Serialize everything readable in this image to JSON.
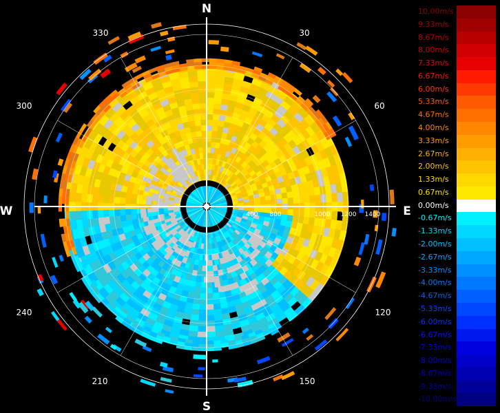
{
  "chart_data": {
    "type": "radar-ppi",
    "compass": {
      "north": "N",
      "east": "E",
      "south": "S",
      "west": "W"
    },
    "azimuth_labels": [
      "30",
      "60",
      "120",
      "150",
      "210",
      "240",
      "300",
      "330"
    ],
    "range_labels": [
      "400",
      "800",
      "1000",
      "1200",
      "1400"
    ],
    "legend": [
      {
        "label": "10.00m/s",
        "color": "#8b0000"
      },
      {
        "label": "9.33m/s",
        "color": "#a00000"
      },
      {
        "label": "8.67m/s",
        "color": "#b80000"
      },
      {
        "label": "8.00m/s",
        "color": "#d00000"
      },
      {
        "label": "7.33m/s",
        "color": "#e80000"
      },
      {
        "label": "6.67m/s",
        "color": "#ff1a00"
      },
      {
        "label": "6.00m/s",
        "color": "#ff3a00"
      },
      {
        "label": "5.33m/s",
        "color": "#ff5a00"
      },
      {
        "label": "4.67m/s",
        "color": "#ff7000"
      },
      {
        "label": "4.00m/s",
        "color": "#ff8800"
      },
      {
        "label": "3.33m/s",
        "color": "#ff9c00"
      },
      {
        "label": "2.67m/s",
        "color": "#ffb000"
      },
      {
        "label": "2.00m/s",
        "color": "#ffc400"
      },
      {
        "label": "1.33m/s",
        "color": "#ffd800"
      },
      {
        "label": "0.67m/s",
        "color": "#ffe800"
      },
      {
        "label": "0.00m/s",
        "color": "#ffffff"
      },
      {
        "label": "-0.67m/s",
        "color": "#00f0ff"
      },
      {
        "label": "-1.33m/s",
        "color": "#00d8ff"
      },
      {
        "label": "-2.00m/s",
        "color": "#00c0ff"
      },
      {
        "label": "-2.67m/s",
        "color": "#00a8ff"
      },
      {
        "label": "-3.33m/s",
        "color": "#0090ff"
      },
      {
        "label": "-4.00m/s",
        "color": "#0078ff"
      },
      {
        "label": "-4.67m/s",
        "color": "#0060ff"
      },
      {
        "label": "-5.33m/s",
        "color": "#0048ff"
      },
      {
        "label": "-6.00m/s",
        "color": "#0030ff"
      },
      {
        "label": "-6.67m/s",
        "color": "#0018f0"
      },
      {
        "label": "-7.33m/s",
        "color": "#0000e0"
      },
      {
        "label": "-8.00m/s",
        "color": "#0000c8"
      },
      {
        "label": "-8.67m/s",
        "color": "#0000b0"
      },
      {
        "label": "-9.33m/s",
        "color": "#000098"
      },
      {
        "label": "-10.00m/s",
        "color": "#000080"
      }
    ],
    "colors": {
      "inner_positive": "#e8c800",
      "inner_negative": "#2ec8d8",
      "clutter": "#c8c8c8",
      "outer_band": "#e07818",
      "grid": "#ffffff",
      "background": "#000000"
    }
  }
}
